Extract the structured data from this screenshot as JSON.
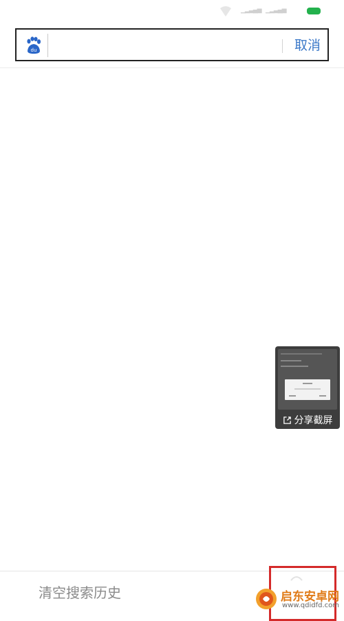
{
  "search": {
    "placeholder": "",
    "cancel_label": "取消"
  },
  "share_popup": {
    "label": "分享截屏"
  },
  "history": {
    "clear_label": "清空搜索历史"
  },
  "watermark": {
    "title": "启东安卓网",
    "url": "www.qdidfd.com"
  },
  "colors": {
    "accent": "#3a78c8",
    "battery": "#23b14d",
    "highlight": "#d42a2a",
    "watermark": "#e07b18"
  },
  "icons": [
    "wifi-icon",
    "signal-icon",
    "battery-icon",
    "baidu-logo-icon",
    "share-icon"
  ]
}
